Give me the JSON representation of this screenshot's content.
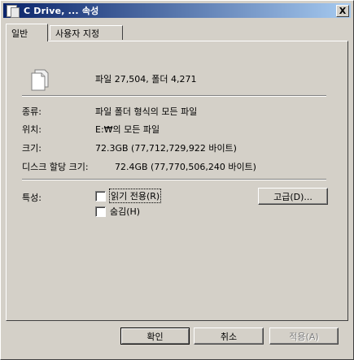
{
  "window": {
    "title": "C Drive, ... 속성",
    "close_label": "X"
  },
  "tabs": [
    {
      "label": "일반"
    },
    {
      "label": "사용자 지정"
    }
  ],
  "summary": "파일 27,504, 폴더 4,271",
  "rows": {
    "type": {
      "label": "종류:",
      "value": "파일 폴더 형식의 모든 파일"
    },
    "location": {
      "label": "위치:",
      "value": "E:₩의 모든 파일"
    },
    "size": {
      "label": "크기:",
      "value": "72.3GB (77,712,729,922 바이트)"
    },
    "disk_size": {
      "label": "디스크 할당 크기:",
      "value": "72.4GB (77,770,506,240 바이트)"
    }
  },
  "attributes": {
    "label": "특성:",
    "readonly_label": "읽기 전용(R)",
    "hidden_label": "숨김(H)",
    "advanced_button": "고급(D)..."
  },
  "buttons": {
    "ok": "확인",
    "cancel": "취소",
    "apply": "적용(A)"
  }
}
